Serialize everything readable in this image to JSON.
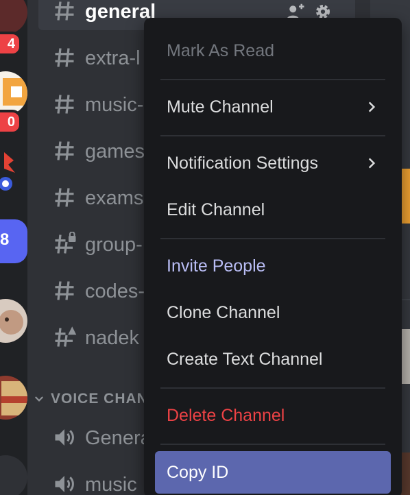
{
  "server_rail": {
    "badges": [
      "4",
      "0"
    ],
    "icons": [
      "server-icon-1",
      "server-icon-2",
      "server-icon-3",
      "server-icon-4",
      "server-icon-5",
      "server-icon-6",
      "server-icon-7"
    ],
    "partial_label": "8"
  },
  "channels": [
    {
      "name": "general",
      "icon": "hash-icon",
      "selected": true
    },
    {
      "name": "extra-l",
      "icon": "hash-icon"
    },
    {
      "name": "music-",
      "icon": "hash-icon"
    },
    {
      "name": "games",
      "icon": "hash-icon"
    },
    {
      "name": "exams",
      "icon": "hash-icon"
    },
    {
      "name": "group-",
      "icon": "locked-hash-icon"
    },
    {
      "name": "codes-",
      "icon": "hash-icon"
    },
    {
      "name": "nadek",
      "icon": "warning-hash-icon"
    }
  ],
  "voice_category": {
    "label": "VOICE CHAN"
  },
  "voice_channels": [
    {
      "name": "Genera",
      "icon": "speaker-icon"
    },
    {
      "name": "music",
      "icon": "speaker-icon"
    }
  ],
  "context_menu": {
    "mark_as_read": "Mark As Read",
    "mute_channel": "Mute Channel",
    "notification_settings": "Notification Settings",
    "edit_channel": "Edit Channel",
    "invite_people": "Invite People",
    "clone_channel": "Clone Channel",
    "create_text_channel": "Create Text Channel",
    "delete_channel": "Delete Channel",
    "copy_id": "Copy ID"
  },
  "colors": {
    "brand": "#5865f2",
    "menu_focus": "#5c67ae",
    "danger": "#ed4245",
    "menu_bg": "#18191c",
    "sidebar_bg": "#2f3136"
  }
}
